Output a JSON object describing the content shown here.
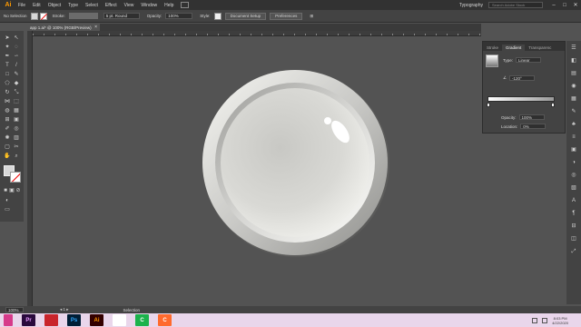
{
  "app": {
    "logo": "Ai",
    "menu": [
      "File",
      "Edit",
      "Object",
      "Type",
      "Select",
      "Effect",
      "View",
      "Window",
      "Help"
    ],
    "workspace": "Typography",
    "search_placeholder": "Search Adobe Stock",
    "window_buttons": [
      "–",
      "□",
      "✕"
    ]
  },
  "control_bar": {
    "selection_label": "No Selection",
    "stroke_label": "Stroke:",
    "stroke_style": "5 pt. Round",
    "opacity_label": "Opacity:",
    "opacity_value": "100%",
    "style_label": "Style:",
    "document_setup": "Document Setup",
    "preferences": "Preferences"
  },
  "document_tab": {
    "title": "app 1.ai* @ 100% (RGB/Preview)",
    "close": "×"
  },
  "gradient_panel": {
    "tabs": [
      "Stroke",
      "Gradient",
      "Transparenc"
    ],
    "active_tab": "Gradient",
    "type_label": "Type:",
    "type_value": "Linear",
    "angle_value": "-120°",
    "opacity_label": "Opacity:",
    "opacity_value": "100%",
    "location_label": "Location:",
    "location_value": "0%"
  },
  "status_bar": {
    "zoom": "100%",
    "page": "1",
    "tool": "Selection"
  },
  "taskbar": {
    "apps": [
      {
        "name": "Premiere Pro",
        "label": "Pr",
        "color": "#2a0a3d",
        "text_color": "#e99bff"
      },
      {
        "name": "Acrobat",
        "label": "",
        "color": "#c9252c",
        "text_color": "#ffffff"
      },
      {
        "name": "Photoshop",
        "label": "Ps",
        "color": "#001e36",
        "text_color": "#31a8ff"
      },
      {
        "name": "Illustrator",
        "label": "Ai",
        "color": "#330000",
        "text_color": "#ff9a00"
      },
      {
        "name": "Chrome",
        "label": "",
        "color": "#ffffff",
        "text_color": "#4285f4"
      },
      {
        "name": "Camtasia",
        "label": "C",
        "color": "#1bb24b",
        "text_color": "#ffffff"
      },
      {
        "name": "Camtasia Recorder",
        "label": "C",
        "color": "#ff6a2d",
        "text_color": "#ffffff"
      }
    ],
    "time": "8:03 PM",
    "date": "4/22/2020"
  },
  "colors": {
    "accent": "#ff9a00",
    "canvas": "#535353",
    "panel": "#434343"
  }
}
